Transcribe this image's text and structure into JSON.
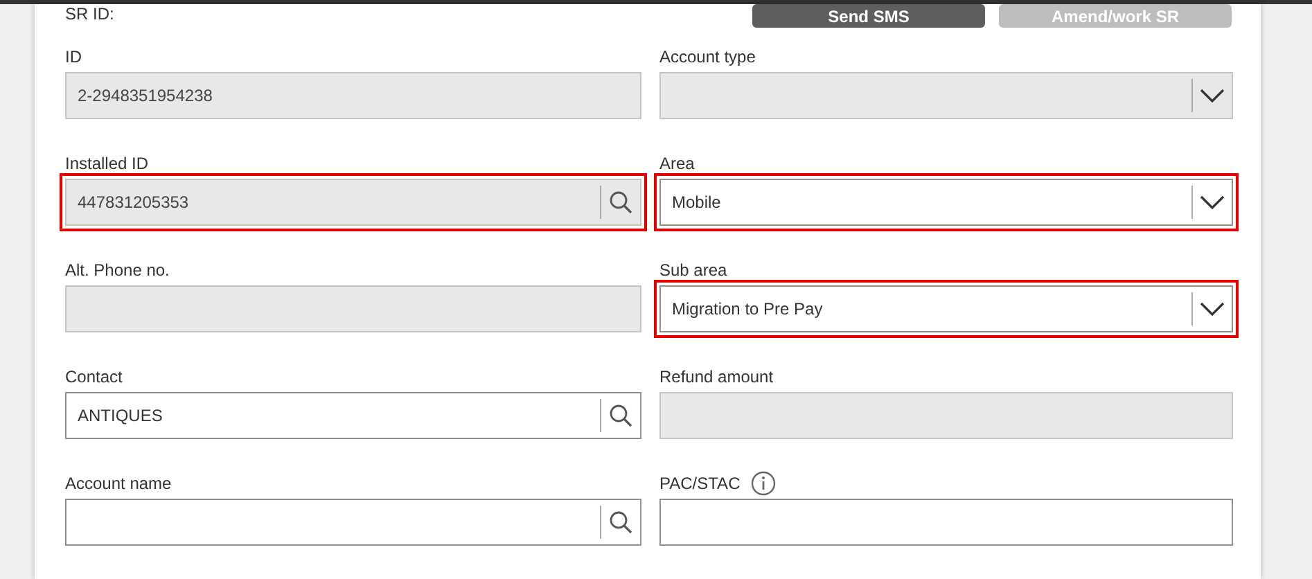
{
  "header": {
    "label": "SR ID:",
    "buttons": [
      {
        "label": "Send SMS",
        "disabled": false
      },
      {
        "label": "Amend/work SR",
        "disabled": true
      }
    ]
  },
  "fields": [
    {
      "label": "ID",
      "kind": "text",
      "disabled": true,
      "highlighted": false,
      "value": "2-2948351954238"
    },
    {
      "label": "Account type",
      "kind": "select",
      "disabled": true,
      "highlighted": false
    },
    {
      "label": "Installed ID",
      "kind": "lookup",
      "disabled": true,
      "highlighted": true,
      "value": "447831205353"
    },
    {
      "label": "Area",
      "kind": "select",
      "disabled": false,
      "highlighted": true,
      "value": "Mobile"
    },
    {
      "label": "Alt. Phone no.",
      "kind": "text",
      "disabled": true,
      "highlighted": false
    },
    {
      "label": "Sub area",
      "kind": "select",
      "disabled": false,
      "highlighted": true,
      "value": "Migration to Pre Pay"
    },
    {
      "label": "Contact",
      "kind": "lookup",
      "disabled": false,
      "highlighted": false,
      "value": "ANTIQUES"
    },
    {
      "label": "Refund amount",
      "kind": "text",
      "disabled": true,
      "highlighted": false
    },
    {
      "label": "Account name",
      "kind": "lookup",
      "disabled": false,
      "highlighted": false
    },
    {
      "label": "PAC/STAC",
      "kind": "text",
      "disabled": false,
      "highlighted": false,
      "info": true
    }
  ]
}
